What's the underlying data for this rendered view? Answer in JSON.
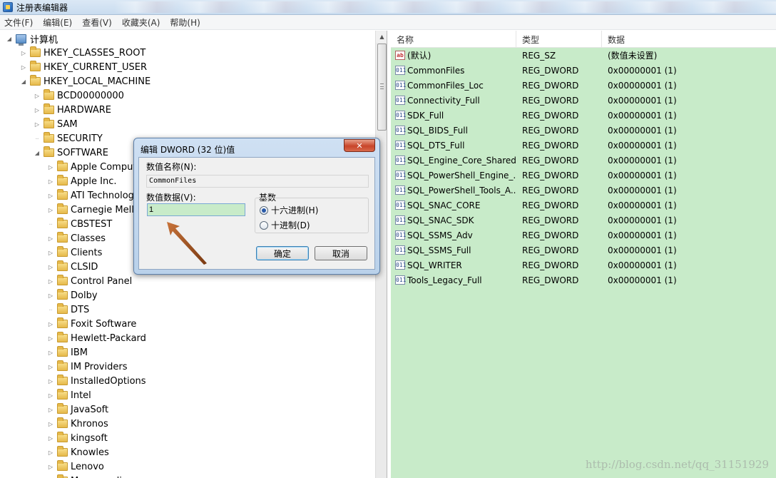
{
  "window": {
    "title": "注册表编辑器"
  },
  "menu": [
    {
      "label": "文件(F)"
    },
    {
      "label": "编辑(E)"
    },
    {
      "label": "查看(V)"
    },
    {
      "label": "收藏夹(A)"
    },
    {
      "label": "帮助(H)"
    }
  ],
  "tree": {
    "root": "计算机",
    "items": [
      {
        "label": "HKEY_CLASSES_ROOT",
        "expander": "collapsed"
      },
      {
        "label": "HKEY_CURRENT_USER",
        "expander": "collapsed"
      },
      {
        "label": "HKEY_LOCAL_MACHINE",
        "expander": "expanded"
      },
      {
        "label": "BCD00000000",
        "expander": "collapsed"
      },
      {
        "label": "HARDWARE",
        "expander": "collapsed"
      },
      {
        "label": "SAM",
        "expander": "collapsed"
      },
      {
        "label": "SECURITY",
        "expander": "none"
      },
      {
        "label": "SOFTWARE",
        "expander": "expanded"
      },
      {
        "label": "Apple Computer, Inc.",
        "expander": "collapsed"
      },
      {
        "label": "Apple Inc.",
        "expander": "collapsed"
      },
      {
        "label": "ATI Technologies",
        "expander": "collapsed"
      },
      {
        "label": "Carnegie Mellon",
        "expander": "collapsed"
      },
      {
        "label": "CBSTEST",
        "expander": "none"
      },
      {
        "label": "Classes",
        "expander": "collapsed"
      },
      {
        "label": "Clients",
        "expander": "collapsed"
      },
      {
        "label": "CLSID",
        "expander": "collapsed"
      },
      {
        "label": "Control Panel",
        "expander": "collapsed"
      },
      {
        "label": "Dolby",
        "expander": "collapsed"
      },
      {
        "label": "DTS",
        "expander": "none"
      },
      {
        "label": "Foxit Software",
        "expander": "collapsed"
      },
      {
        "label": "Hewlett-Packard",
        "expander": "collapsed"
      },
      {
        "label": "IBM",
        "expander": "collapsed"
      },
      {
        "label": "IM Providers",
        "expander": "collapsed"
      },
      {
        "label": "InstalledOptions",
        "expander": "collapsed"
      },
      {
        "label": "Intel",
        "expander": "collapsed"
      },
      {
        "label": "JavaSoft",
        "expander": "collapsed"
      },
      {
        "label": "Khronos",
        "expander": "collapsed"
      },
      {
        "label": "kingsoft",
        "expander": "collapsed"
      },
      {
        "label": "Knowles",
        "expander": "collapsed"
      },
      {
        "label": "Lenovo",
        "expander": "collapsed"
      },
      {
        "label": "Macromedia",
        "expander": "collapsed"
      }
    ]
  },
  "list": {
    "headers": {
      "name": "名称",
      "type": "类型",
      "data": "数据"
    },
    "rows": [
      {
        "icon": "ab",
        "name": "(默认)",
        "type": "REG_SZ",
        "data": "(数值未设置)"
      },
      {
        "icon": "011",
        "name": "CommonFiles",
        "type": "REG_DWORD",
        "data": "0x00000001 (1)"
      },
      {
        "icon": "011",
        "name": "CommonFiles_Loc",
        "type": "REG_DWORD",
        "data": "0x00000001 (1)"
      },
      {
        "icon": "011",
        "name": "Connectivity_Full",
        "type": "REG_DWORD",
        "data": "0x00000001 (1)"
      },
      {
        "icon": "011",
        "name": "SDK_Full",
        "type": "REG_DWORD",
        "data": "0x00000001 (1)"
      },
      {
        "icon": "011",
        "name": "SQL_BIDS_Full",
        "type": "REG_DWORD",
        "data": "0x00000001 (1)"
      },
      {
        "icon": "011",
        "name": "SQL_DTS_Full",
        "type": "REG_DWORD",
        "data": "0x00000001 (1)"
      },
      {
        "icon": "011",
        "name": "SQL_Engine_Core_Shared",
        "type": "REG_DWORD",
        "data": "0x00000001 (1)"
      },
      {
        "icon": "011",
        "name": "SQL_PowerShell_Engine_...",
        "type": "REG_DWORD",
        "data": "0x00000001 (1)"
      },
      {
        "icon": "011",
        "name": "SQL_PowerShell_Tools_A...",
        "type": "REG_DWORD",
        "data": "0x00000001 (1)"
      },
      {
        "icon": "011",
        "name": "SQL_SNAC_CORE",
        "type": "REG_DWORD",
        "data": "0x00000001 (1)"
      },
      {
        "icon": "011",
        "name": "SQL_SNAC_SDK",
        "type": "REG_DWORD",
        "data": "0x00000001 (1)"
      },
      {
        "icon": "011",
        "name": "SQL_SSMS_Adv",
        "type": "REG_DWORD",
        "data": "0x00000001 (1)"
      },
      {
        "icon": "011",
        "name": "SQL_SSMS_Full",
        "type": "REG_DWORD",
        "data": "0x00000001 (1)"
      },
      {
        "icon": "011",
        "name": "SQL_WRITER",
        "type": "REG_DWORD",
        "data": "0x00000001 (1)"
      },
      {
        "icon": "011",
        "name": "Tools_Legacy_Full",
        "type": "REG_DWORD",
        "data": "0x00000001 (1)"
      }
    ],
    "watermark": "http://blog.csdn.net/qq_31151929"
  },
  "dialog": {
    "title": "编辑 DWORD (32 位)值",
    "close_label": "✕",
    "value_name_label": "数值名称(N):",
    "value_name": "CommonFiles",
    "value_data_label": "数值数据(V):",
    "value_data": "1",
    "base_label": "基数",
    "hex_label": "十六进制(H)",
    "dec_label": "十进制(D)",
    "base_selected": "hex",
    "ok_label": "确定",
    "cancel_label": "取消"
  },
  "colors": {
    "list_background": "#c8ebc9",
    "annotation_arrow": "#a0521e"
  }
}
